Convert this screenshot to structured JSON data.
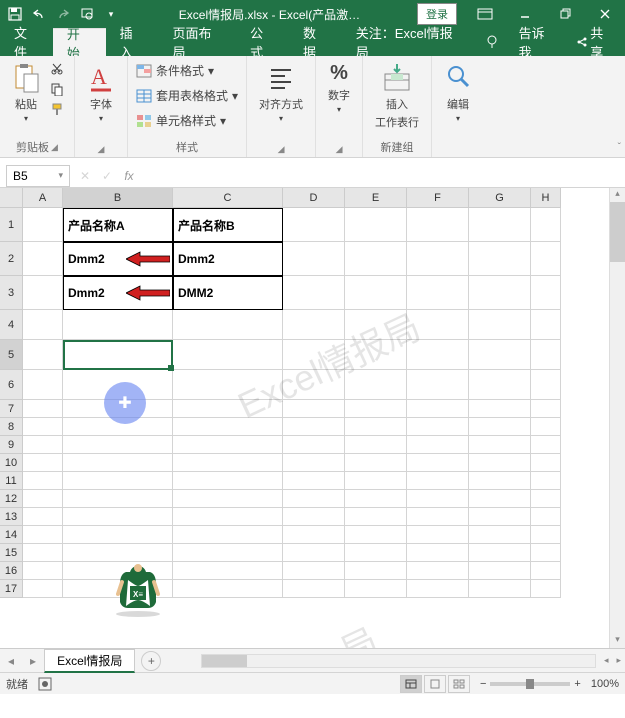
{
  "titlebar": {
    "filename": "Excel情报局.xlsx",
    "app": "Excel(产品激…",
    "login": "登录"
  },
  "tabs": {
    "file": "文件",
    "home": "开始",
    "insert": "插入",
    "layout": "页面布局",
    "formulas": "公式",
    "data": "数据",
    "follow": "关注：Excel情报局",
    "tellme": "告诉我",
    "share": "共享"
  },
  "ribbon": {
    "clipboard": {
      "paste": "粘贴",
      "label": "剪贴板"
    },
    "font": {
      "btn": "字体",
      "label": ""
    },
    "styles": {
      "cond": "条件格式",
      "table": "套用表格格式",
      "cell": "单元格样式",
      "label": "样式"
    },
    "align": {
      "btn": "对齐方式",
      "label": ""
    },
    "number": {
      "btn": "数字",
      "label": ""
    },
    "cells": {
      "insert": "插入",
      "worksheet": "工作表行",
      "label": "新建组"
    },
    "editing": {
      "btn": "编辑",
      "label": ""
    }
  },
  "namebox": {
    "value": "B5"
  },
  "columns": [
    "A",
    "B",
    "C",
    "D",
    "E",
    "F",
    "G",
    "H"
  ],
  "rows": [
    1,
    2,
    3,
    4,
    5,
    6,
    7,
    8,
    9,
    10,
    11,
    12,
    13,
    14,
    15,
    16,
    17
  ],
  "data": {
    "b1": "产品名称A",
    "c1": "产品名称B",
    "b2": "Dmm2",
    "c2": "Dmm2",
    "b3": "Dmm2",
    "c3": "DMM2"
  },
  "watermark1": "Excel情报局",
  "watermark2": "局",
  "sheet": {
    "name": "Excel情报局"
  },
  "status": {
    "ready": "就绪",
    "zoom": "100%"
  }
}
